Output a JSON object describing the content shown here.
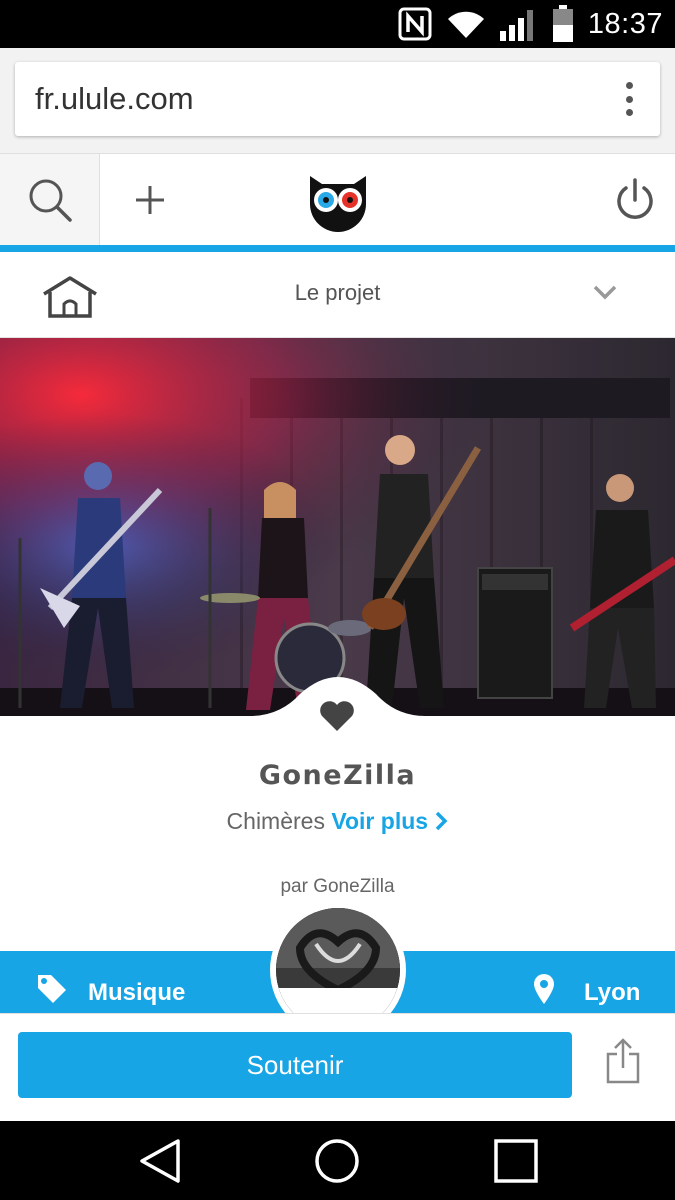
{
  "status_bar": {
    "time": "18:37",
    "icons": [
      "nfc-icon",
      "wifi-icon",
      "signal-icon",
      "battery-icon"
    ]
  },
  "browser": {
    "url": "fr.ulule.com",
    "menu_icon": "more-vert-icon"
  },
  "header": {
    "icons": [
      "search-icon",
      "plus-icon",
      "ulule-owl-logo",
      "power-icon"
    ],
    "accent_color": "#18a5e6"
  },
  "project_nav": {
    "label": "Le projet",
    "home_icon": "home-icon",
    "dropdown_icon": "chevron-down-icon"
  },
  "project": {
    "title": "GoneZilla",
    "subtitle": "Chimères",
    "more_link": "Voir plus",
    "author": "par GoneZilla",
    "category": "Musique",
    "location": "Lyon"
  },
  "actions": {
    "support_label": "Soutenir",
    "share_icon": "share-icon"
  },
  "android_nav": {
    "icons": [
      "back-icon",
      "home-circle-icon",
      "recents-icon"
    ]
  }
}
